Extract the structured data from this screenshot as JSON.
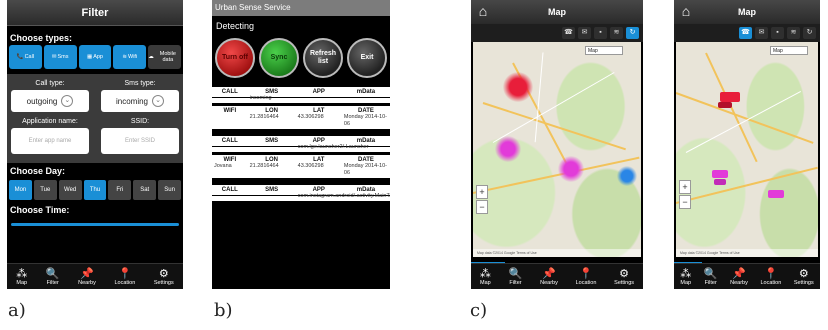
{
  "captions": [
    "a)",
    "b)",
    "c)"
  ],
  "nav_items": [
    {
      "label": "Map",
      "icon": "map-pin-dots-icon",
      "glyph": "⁂"
    },
    {
      "label": "Filter",
      "icon": "search-icon",
      "glyph": "🔍"
    },
    {
      "label": "Nearby",
      "icon": "pushpin-icon",
      "glyph": "📌"
    },
    {
      "label": "Location",
      "icon": "location-marker-icon",
      "glyph": "📍"
    },
    {
      "label": "Settings",
      "icon": "gear-icon",
      "glyph": "⚙"
    }
  ],
  "filter_screen": {
    "title": "Filter",
    "choose_types_label": "Choose types:",
    "types": [
      {
        "label": "Call",
        "glyph": "📞",
        "active": true
      },
      {
        "label": "Sms",
        "glyph": "✉",
        "active": true
      },
      {
        "label": "App",
        "glyph": "▦",
        "active": true
      },
      {
        "label": "Wifi",
        "glyph": "≋",
        "active": true
      },
      {
        "label": "Mobile data",
        "glyph": "☁",
        "active": false
      }
    ],
    "call_type_label": "Call type:",
    "call_type_value": "outgoing",
    "sms_type_label": "Sms type:",
    "sms_type_value": "incoming",
    "app_name_label": "Application name:",
    "app_name_placeholder": "Enter app name",
    "ssid_label": "SSID:",
    "ssid_placeholder": "Enter SSID",
    "choose_day_label": "Choose Day:",
    "days": [
      {
        "label": "Mon",
        "active": true
      },
      {
        "label": "Tue",
        "active": false
      },
      {
        "label": "Wed",
        "active": false
      },
      {
        "label": "Thu",
        "active": true
      },
      {
        "label": "Fri",
        "active": false
      },
      {
        "label": "Sat",
        "active": false
      },
      {
        "label": "Sun",
        "active": false
      }
    ],
    "choose_time_label": "Choose Time:"
  },
  "service_screen": {
    "title": "Urban Sense Service",
    "status": "Detecting",
    "buttons": [
      "Turn off",
      "Sync",
      "Refresh list",
      "Exit"
    ],
    "headers_a": [
      "CALL",
      "SMS",
      "APP",
      "mData"
    ],
    "headers_b": [
      "WIFI",
      "LON",
      "LAT",
      "DATE"
    ],
    "records": [
      {
        "a": [
          "",
          "incoming",
          "",
          ""
        ],
        "b": [
          "",
          "21.2816464",
          "43.306298",
          "Monday 2014-10-06"
        ]
      },
      {
        "a": [
          "",
          "",
          "com.lge.launcher2/.Launcher",
          ""
        ],
        "b": [
          "Jovana",
          "21.2816464",
          "43.306298",
          "Monday 2014-10-06"
        ]
      },
      {
        "a": [
          "",
          "",
          "com.instagram.android/.activity.MainTabAct",
          ""
        ],
        "b": null
      }
    ]
  },
  "map_screens": [
    {
      "title": "Map",
      "map_type": "Map",
      "toolbar": [
        "phone-icon",
        "sms-icon",
        "app-icon",
        "wifi-icon",
        "refresh-icon"
      ],
      "active_tool": 4,
      "footer": "Map data ©2014 Google  Terms of Use"
    },
    {
      "title": "Map",
      "map_type": "Map",
      "toolbar": [
        "phone-icon",
        "sms-icon",
        "app-icon",
        "wifi-icon",
        "refresh-icon"
      ],
      "active_tool": 0,
      "footer": "Map data ©2014 Google  Terms of Use"
    }
  ],
  "colors": {
    "accent": "#1a8fd6",
    "heat_red": "#e81e3a",
    "heat_magenta": "#e23bd9",
    "heat_blue": "#2a86e6",
    "road": "#f2c35b"
  }
}
